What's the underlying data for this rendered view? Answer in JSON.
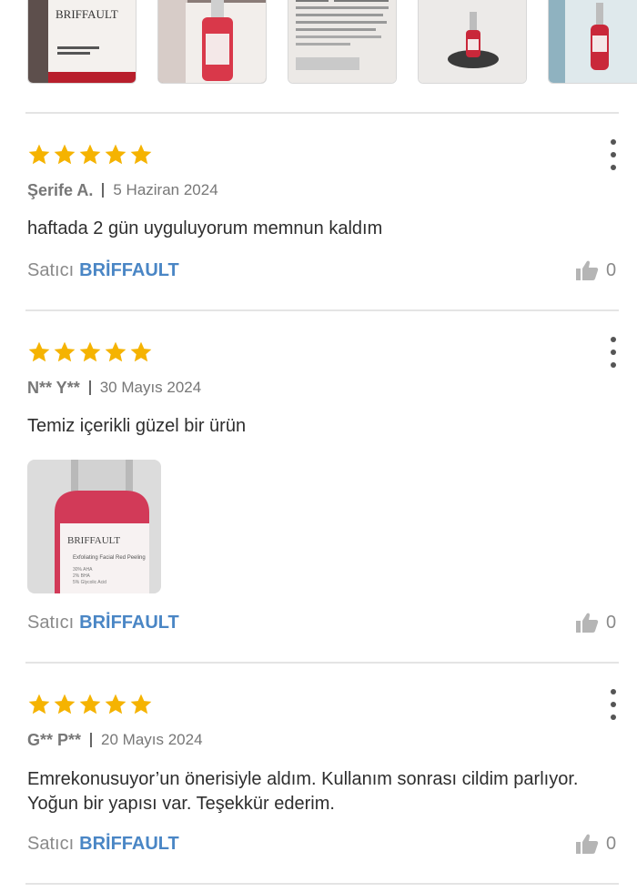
{
  "gallery": {
    "thumbnails": [
      {
        "label": "product-box-front"
      },
      {
        "label": "serum-bottle-on-box"
      },
      {
        "label": "box-back-text"
      },
      {
        "label": "serum-bottle-on-stand"
      },
      {
        "label": "serum-bottle-partial"
      }
    ],
    "brand_text": "BRIFFAULT",
    "box_text": "Exfoliating Facial Red Peeling"
  },
  "reviews": [
    {
      "rating": 5,
      "author": "Şerife A.",
      "date": "5 Haziran 2024",
      "text": "haftada 2 gün uyguluyorum memnun kaldım",
      "seller_label": "Satıcı",
      "seller_name": "BRİFFAULT",
      "likes": "0"
    },
    {
      "rating": 5,
      "author": "N** Y**",
      "date": "30 Mayıs 2024",
      "text": "Temiz içerikli güzel bir ürün",
      "has_photo": true,
      "photo_brand": "BRIFFAULT",
      "photo_product": "Exfoliating Facial Red Peeling",
      "photo_ingredients": [
        "30% AHA",
        "2% BHA",
        "5% Glycolic Acid"
      ],
      "seller_label": "Satıcı",
      "seller_name": "BRİFFAULT",
      "likes": "0"
    },
    {
      "rating": 5,
      "author": "G** P**",
      "date": "20 Mayıs 2024",
      "text": "Emrekonusuyor’un önerisiyle aldım. Kullanım sonrası cildim parlıyor. Yoğun bir yapısı var. Teşekkür ederim.",
      "seller_label": "Satıcı",
      "seller_name": "BRİFFAULT",
      "likes": "0"
    }
  ],
  "colors": {
    "star": "#f5b301",
    "seller_link": "#4a86c5",
    "muted_text": "#8a8a8a",
    "divider": "#e4e4e4"
  }
}
